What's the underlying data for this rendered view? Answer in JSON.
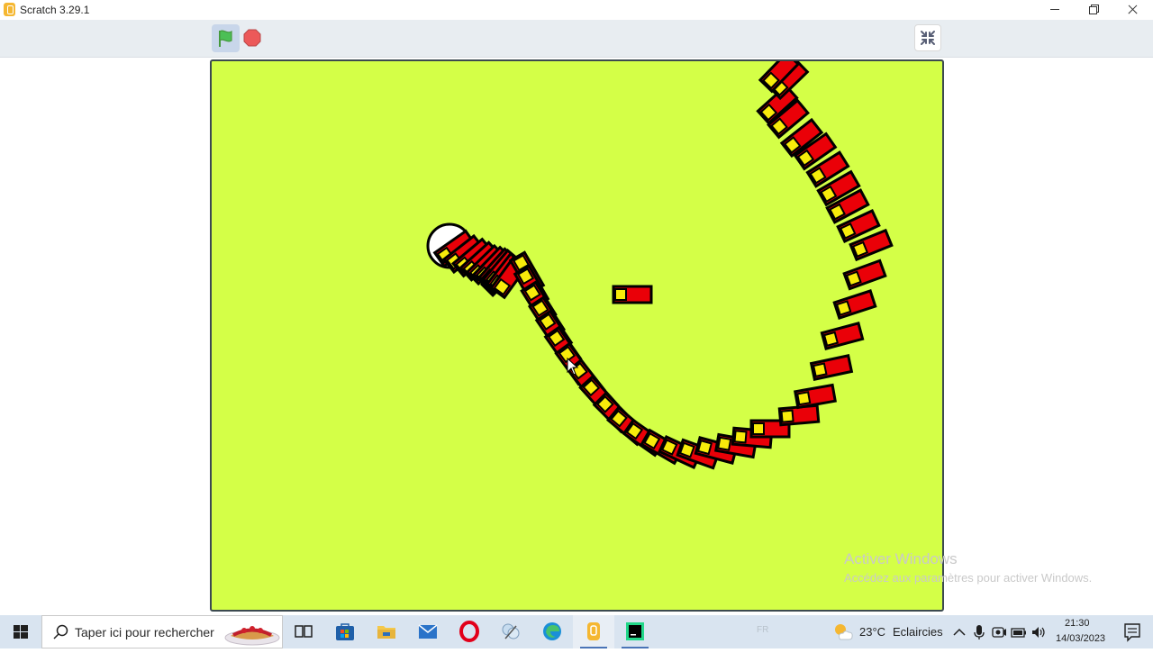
{
  "window": {
    "title": "Scratch 3.29.1"
  },
  "colors": {
    "stage_background": "#d4ff47",
    "block_red": "#ea0008",
    "block_yellow": "#f8eb0a",
    "outline": "#000000",
    "green_flag": "#4cbf56",
    "stop": "#ec5959"
  },
  "header": {
    "green_flag_icon": "green-flag-icon",
    "stop_icon": "stop-sign-icon",
    "exit_fullscreen_icon": "exit-fullscreen-icon"
  },
  "watermark": {
    "title": "Activer Windows",
    "subtitle": "Accédez aux paramètres pour activer Windows."
  },
  "taskbar": {
    "search_placeholder": "Taper ici pour rechercher",
    "pinned_apps": [
      "task-view",
      "microsoft-store",
      "file-explorer",
      "mail",
      "opera",
      "snipping-tool",
      "edge",
      "scratch",
      "pycharm"
    ],
    "active_app": "scratch",
    "language": "FR",
    "weather": {
      "temp": "23°C",
      "desc": "Eclaircies"
    },
    "clock": {
      "time": "21:30",
      "date": "14/03/2023"
    }
  }
}
